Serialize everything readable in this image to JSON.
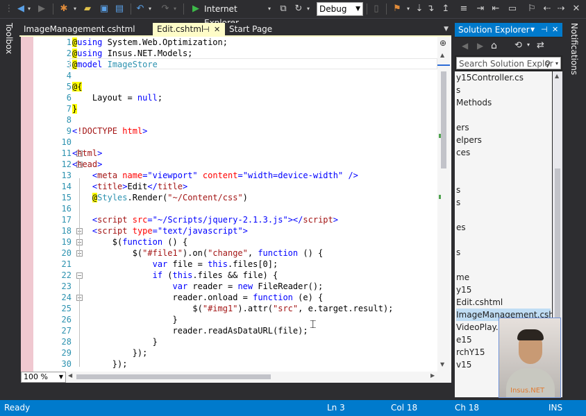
{
  "toolbar": {
    "run_target": "Internet Explorer",
    "configuration": "Debug"
  },
  "side_strips": {
    "left": "Toolbox",
    "right": "Notifications"
  },
  "tabs": [
    {
      "label": "ImageManagement.cshtml",
      "active": false
    },
    {
      "label": "Edit.cshtml",
      "active": true
    },
    {
      "label": "Start Page",
      "active": false
    }
  ],
  "editor": {
    "zoom": "100 %",
    "lines": [
      {
        "n": "1",
        "fold": false,
        "html": "<span class=\"at\">@</span><span class=\"kw\">using</span> System.Web.Optimization;"
      },
      {
        "n": "2",
        "fold": false,
        "html": "<span class=\"at\">@</span><span class=\"kw\">using</span> Insus.NET.Models;"
      },
      {
        "n": "3",
        "fold": false,
        "html": "<span class=\"at\">@</span><span class=\"kw\">model</span> <span class=\"type\">ImageStore</span>"
      },
      {
        "n": "4",
        "fold": false,
        "html": ""
      },
      {
        "n": "5",
        "fold": false,
        "html": "<span class=\"at\">@{</span>"
      },
      {
        "n": "6",
        "fold": false,
        "html": "    Layout = <span class=\"kw\">null</span>;"
      },
      {
        "n": "7",
        "fold": false,
        "html": "<span class=\"at\">}</span>"
      },
      {
        "n": "8",
        "fold": false,
        "html": ""
      },
      {
        "n": "9",
        "fold": false,
        "html": "<span class=\"kw\">&lt;</span><span class=\"tag\">!DOCTYPE</span> <span class=\"attr\">html</span><span class=\"kw\">&gt;</span>"
      },
      {
        "n": "10",
        "fold": false,
        "html": ""
      },
      {
        "n": "11",
        "fold": true,
        "html": "<span class=\"kw\">&lt;</span><span class=\"tag\">html</span><span class=\"kw\">&gt;</span>"
      },
      {
        "n": "12",
        "fold": true,
        "html": "<span class=\"kw\">&lt;</span><span class=\"tag\">head</span><span class=\"kw\">&gt;</span>"
      },
      {
        "n": "13",
        "fold": false,
        "html": "    <span class=\"kw\">&lt;</span><span class=\"tag\">meta</span> <span class=\"attr\">name</span><span class=\"kw\">=\"viewport\"</span> <span class=\"attr\">content</span><span class=\"kw\">=\"width=device-width\"</span> <span class=\"kw\">/&gt;</span>"
      },
      {
        "n": "14",
        "fold": false,
        "html": "    <span class=\"kw\">&lt;</span><span class=\"tag\">title</span><span class=\"kw\">&gt;</span>Edit<span class=\"kw\">&lt;/</span><span class=\"tag\">title</span><span class=\"kw\">&gt;</span>"
      },
      {
        "n": "15",
        "fold": false,
        "html": "    <span class=\"at\">@</span><span class=\"type\">Styles</span>.Render(<span class=\"jsstr\">\"~/Content/css\"</span>)"
      },
      {
        "n": "16",
        "fold": false,
        "html": ""
      },
      {
        "n": "17",
        "fold": false,
        "html": "    <span class=\"kw\">&lt;</span><span class=\"tag\">script</span> <span class=\"attr\">src</span><span class=\"kw\">=\"~/Scripts/jquery-2.1.3.js\"&gt;&lt;/</span><span class=\"tag\">script</span><span class=\"kw\">&gt;</span>"
      },
      {
        "n": "18",
        "fold": true,
        "html": "    <span class=\"kw\">&lt;</span><span class=\"tag\">script</span> <span class=\"attr\">type</span><span class=\"kw\">=\"text/javascript\"&gt;</span>"
      },
      {
        "n": "19",
        "fold": true,
        "html": "        $(<span class=\"kw\">function</span> () {"
      },
      {
        "n": "20",
        "fold": true,
        "html": "            $(<span class=\"jsstr\">\"#file1\"</span>).on(<span class=\"jsstr\">\"change\"</span>, <span class=\"kw\">function</span> () {"
      },
      {
        "n": "21",
        "fold": false,
        "html": "                <span class=\"kw\">var</span> file = <span class=\"kw\">this</span>.files[0];"
      },
      {
        "n": "22",
        "fold": true,
        "html": "                <span class=\"kw\">if</span> (<span class=\"kw\">this</span>.files &amp;&amp; file) {"
      },
      {
        "n": "23",
        "fold": false,
        "html": "                    <span class=\"kw\">var</span> reader = <span class=\"kw\">new</span> FileReader();"
      },
      {
        "n": "24",
        "fold": true,
        "html": "                    reader.onload = <span class=\"kw\">function</span> (e) {"
      },
      {
        "n": "25",
        "fold": false,
        "html": "                        $(<span class=\"jsstr\">\"#img1\"</span>).attr(<span class=\"jsstr\">\"src\"</span>, e.target.result);"
      },
      {
        "n": "26",
        "fold": false,
        "html": "                    }"
      },
      {
        "n": "27",
        "fold": false,
        "html": "                    reader.readAsDataURL(file);"
      },
      {
        "n": "28",
        "fold": false,
        "html": "                }"
      },
      {
        "n": "29",
        "fold": false,
        "html": "            });"
      },
      {
        "n": "30",
        "fold": false,
        "html": "        });"
      }
    ]
  },
  "solution_explorer": {
    "title": "Solution Explorer",
    "search_placeholder": "Search Solution Explor",
    "items": [
      {
        "label": "y15Controller.cs",
        "selected": false
      },
      {
        "label": "s",
        "selected": false
      },
      {
        "label": "Methods",
        "selected": false
      },
      {
        "label": "",
        "selected": false
      },
      {
        "label": "ers",
        "selected": false
      },
      {
        "label": "elpers",
        "selected": false
      },
      {
        "label": "ces",
        "selected": false
      },
      {
        "label": "",
        "selected": false
      },
      {
        "label": "",
        "selected": false
      },
      {
        "label": "s",
        "selected": false
      },
      {
        "label": "s",
        "selected": false
      },
      {
        "label": "",
        "selected": false
      },
      {
        "label": "es",
        "selected": false
      },
      {
        "label": "",
        "selected": false
      },
      {
        "label": "s",
        "selected": false
      },
      {
        "label": "",
        "selected": false
      },
      {
        "label": "me",
        "selected": false
      },
      {
        "label": "y15",
        "selected": false
      },
      {
        "label": "Edit.cshtml",
        "selected": false
      },
      {
        "label": "ImageManagement.cshtml",
        "selected": true
      },
      {
        "label": "VideoPlay.cshtml",
        "selected": false
      },
      {
        "label": "e15",
        "selected": false
      },
      {
        "label": "rchY15",
        "selected": false
      },
      {
        "label": "v15",
        "selected": false
      }
    ]
  },
  "webcam": {
    "label": "Insus.NET"
  },
  "status": {
    "ready": "Ready",
    "ln": "Ln 3",
    "col": "Col 18",
    "ch": "Ch 18",
    "mode": "INS"
  },
  "colors": {
    "accent": "#007acc",
    "tab_active": "#fefcc8",
    "margin": "#f0c8d0"
  }
}
